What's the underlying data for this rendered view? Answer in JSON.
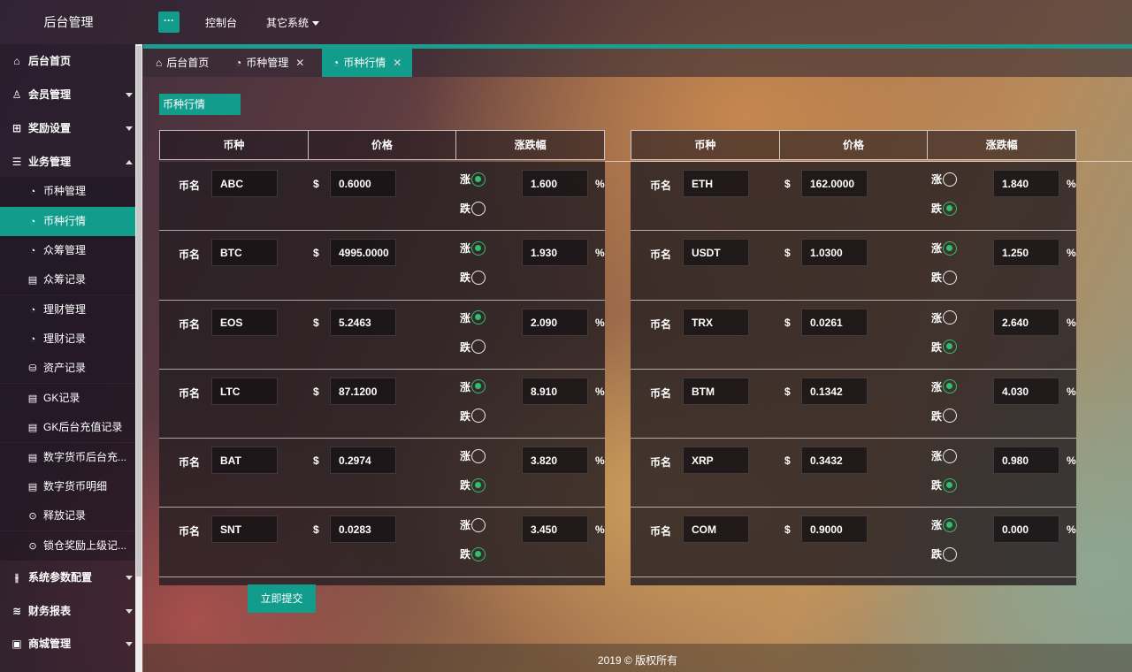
{
  "app": {
    "brand": "后台管理",
    "menu_toggle": "···"
  },
  "topnav": {
    "dashboard": "控制台",
    "other_systems": "其它系统"
  },
  "sidebar": {
    "items": [
      {
        "label": "后台首页",
        "icon": "home-icon"
      },
      {
        "label": "会员管理",
        "icon": "users-icon"
      },
      {
        "label": "奖励设置",
        "icon": "gift-icon"
      },
      {
        "label": "业务管理",
        "icon": "list-icon"
      }
    ],
    "business_sub": [
      {
        "label": "币种管理",
        "icon": "coin-icon"
      },
      {
        "label": "币种行情",
        "icon": "coin-icon",
        "active": true
      },
      {
        "label": "众筹管理",
        "icon": "coin-icon"
      },
      {
        "label": "众筹记录",
        "icon": "doc-icon"
      },
      {
        "label": "理财管理",
        "icon": "coin-icon"
      },
      {
        "label": "理财记录",
        "icon": "coin-icon"
      },
      {
        "label": "资产记录",
        "icon": "database-icon"
      },
      {
        "label": "GK记录",
        "icon": "doc-icon"
      },
      {
        "label": "GK后台充值记录",
        "icon": "doc-icon"
      },
      {
        "label": "数字货币后台充...",
        "icon": "doc-icon"
      },
      {
        "label": "数字货币明细",
        "icon": "doc-icon"
      },
      {
        "label": "释放记录",
        "icon": "yen-icon"
      },
      {
        "label": "锁仓奖励上级记...",
        "icon": "yen-icon"
      }
    ],
    "bottom_items": [
      {
        "label": "系统参数配置",
        "icon": "sliders-icon"
      },
      {
        "label": "财务报表",
        "icon": "chart-icon"
      },
      {
        "label": "商城管理",
        "icon": "shop-icon"
      }
    ]
  },
  "tabs": [
    {
      "label": "后台首页",
      "closable": false
    },
    {
      "label": "币种管理",
      "closable": true
    },
    {
      "label": "币种行情",
      "closable": true,
      "active": true
    }
  ],
  "section": {
    "label": "币种行情"
  },
  "table_headers": {
    "coin": "币种",
    "price": "价格",
    "change": "涨跌幅"
  },
  "row_labels": {
    "name": "币名",
    "dollar": "$",
    "up": "涨",
    "down": "跌",
    "percent": "%"
  },
  "markets": {
    "left": [
      {
        "name": "ABC",
        "price": "0.6000",
        "direction": "up",
        "change": "1.600"
      },
      {
        "name": "BTC",
        "price": "4995.0000",
        "direction": "up",
        "change": "1.930"
      },
      {
        "name": "EOS",
        "price": "5.2463",
        "direction": "up",
        "change": "2.090"
      },
      {
        "name": "LTC",
        "price": "87.1200",
        "direction": "up",
        "change": "8.910"
      },
      {
        "name": "BAT",
        "price": "0.2974",
        "direction": "down",
        "change": "3.820"
      },
      {
        "name": "SNT",
        "price": "0.0283",
        "direction": "down",
        "change": "3.450"
      }
    ],
    "right": [
      {
        "name": "ETH",
        "price": "162.0000",
        "direction": "down",
        "change": "1.840"
      },
      {
        "name": "USDT",
        "price": "1.0300",
        "direction": "up",
        "change": "1.250"
      },
      {
        "name": "TRX",
        "price": "0.0261",
        "direction": "down",
        "change": "2.640"
      },
      {
        "name": "BTM",
        "price": "0.1342",
        "direction": "up",
        "change": "4.030"
      },
      {
        "name": "XRP",
        "price": "0.3432",
        "direction": "down",
        "change": "0.980"
      },
      {
        "name": "COM",
        "price": "0.9000",
        "direction": "up",
        "change": "0.000"
      }
    ]
  },
  "actions": {
    "submit": "立即提交"
  },
  "footer": {
    "text": "2019 © 版权所有"
  },
  "colors": {
    "accent": "#129c8c",
    "radio_on": "#2fbf71"
  }
}
